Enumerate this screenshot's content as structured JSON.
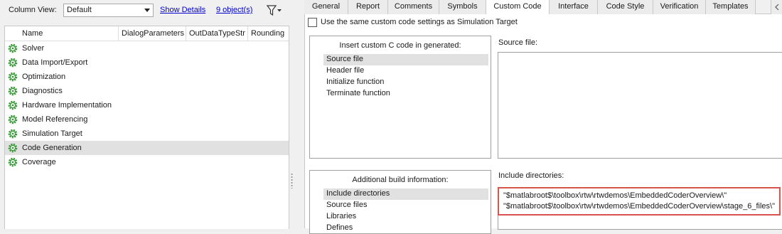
{
  "toolbar": {
    "column_view_label": "Column View:",
    "column_view_value": "Default",
    "show_details": "Show Details",
    "objects_count": "9 object(s)"
  },
  "tree": {
    "columns": [
      "Name",
      "DialogParameters",
      "OutDataTypeStr",
      "Rounding"
    ],
    "items": [
      {
        "label": "Solver"
      },
      {
        "label": "Data Import/Export"
      },
      {
        "label": "Optimization"
      },
      {
        "label": "Diagnostics"
      },
      {
        "label": "Hardware Implementation"
      },
      {
        "label": "Model Referencing"
      },
      {
        "label": "Simulation Target"
      },
      {
        "label": "Code Generation"
      },
      {
        "label": "Coverage"
      }
    ],
    "selected": "Code Generation"
  },
  "tabs": [
    "General",
    "Report",
    "Comments",
    "Symbols",
    "Custom Code",
    "Interface",
    "Code Style",
    "Verification",
    "Templates"
  ],
  "active_tab": "Custom Code",
  "custom_code": {
    "use_same_label": "Use the same custom code settings as Simulation Target",
    "use_same_checked": false,
    "insert_group_title": "Insert custom C code in generated:",
    "insert_items": [
      "Source file",
      "Header file",
      "Initialize function",
      "Terminate function"
    ],
    "insert_selected": "Source file",
    "source_file_label": "Source file:",
    "build_group_title": "Additional build information:",
    "build_items": [
      "Include directories",
      "Source files",
      "Libraries",
      "Defines"
    ],
    "build_selected": "Include directories",
    "include_dirs_label": "Include directories:",
    "include_dirs": [
      "\"$matlabroot$\\toolbox\\rtw\\rtwdemos\\EmbeddedCoderOverview\\\"",
      "\"$matlabroot$\\toolbox\\rtw\\rtwdemos\\EmbeddedCoderOverview\\stage_6_files\\\""
    ]
  },
  "colors": {
    "selection": "#e1e1e1",
    "link": "#0000cc",
    "gear": "#3a9a3a",
    "highlight_border": "#d9534f"
  }
}
